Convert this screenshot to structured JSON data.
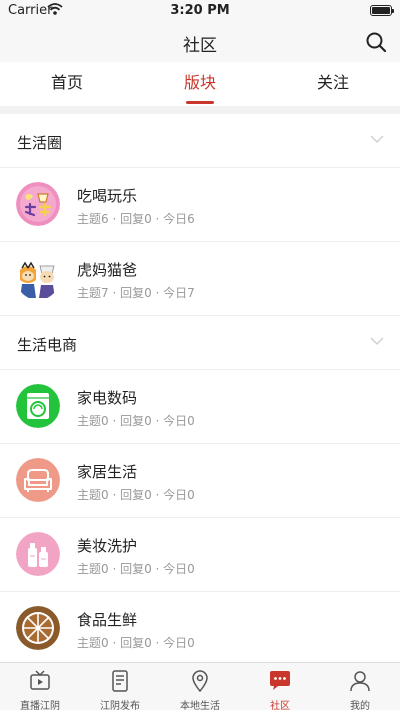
{
  "status_bar": {
    "carrier": "Carrier",
    "time": "3:20 PM"
  },
  "nav": {
    "title": "社区"
  },
  "tabs": [
    {
      "label": "首页"
    },
    {
      "label": "版块"
    },
    {
      "label": "关注"
    }
  ],
  "active_tab": "版块",
  "sections": [
    {
      "title": "生活圈",
      "forums": [
        {
          "name": "吃喝玩乐",
          "stats": "主题6 · 回复0 · 今日6",
          "icon": "food-fun-icon"
        },
        {
          "name": "虎妈猫爸",
          "stats": "主题7 · 回复0 · 今日7",
          "icon": "parents-icon"
        }
      ]
    },
    {
      "title": "生活电商",
      "forums": [
        {
          "name": "家电数码",
          "stats": "主题0 · 回复0 · 今日0",
          "icon": "washing-machine-icon"
        },
        {
          "name": "家居生活",
          "stats": "主题0 · 回复0 · 今日0",
          "icon": "sofa-icon"
        },
        {
          "name": "美妆洗护",
          "stats": "主题0 · 回复0 · 今日0",
          "icon": "cosmetics-icon"
        },
        {
          "name": "食品生鲜",
          "stats": "主题0 · 回复0 · 今日0",
          "icon": "orange-slice-icon"
        }
      ]
    }
  ],
  "tabbar": [
    {
      "label": "直播江阴",
      "icon": "tv-icon"
    },
    {
      "label": "江阴发布",
      "icon": "document-icon"
    },
    {
      "label": "本地生活",
      "icon": "location-pin-icon"
    },
    {
      "label": "社区",
      "icon": "chat-bubble-icon"
    },
    {
      "label": "我的",
      "icon": "person-icon"
    }
  ],
  "colors": {
    "accent": "#c9372c",
    "muted_text": "#999999",
    "background": "#f2f2f2"
  }
}
